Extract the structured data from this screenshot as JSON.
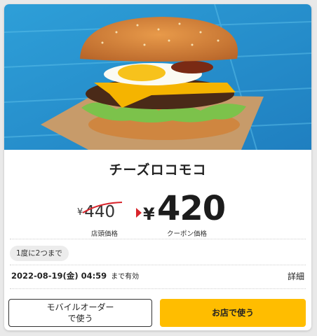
{
  "product": {
    "name": "チーズロコモコ"
  },
  "pricing": {
    "currency_symbol": "¥",
    "store_price": "440",
    "store_price_caption": "店頭価格",
    "coupon_price": "420",
    "coupon_price_caption": "クーポン価格"
  },
  "badge": {
    "text": "1度に2つまで"
  },
  "expiry": {
    "datetime": "2022-08-19(金) 04:59",
    "suffix": "まで有効"
  },
  "links": {
    "detail": "詳細"
  },
  "buttons": {
    "mobile_order_line1": "モバイルオーダー",
    "mobile_order_line2": "で使う",
    "use_in_store": "お店で使う"
  },
  "colors": {
    "accent_yellow": "#ffbd00",
    "strike_red": "#d8242b",
    "background_blue": "#3aa6d6"
  }
}
